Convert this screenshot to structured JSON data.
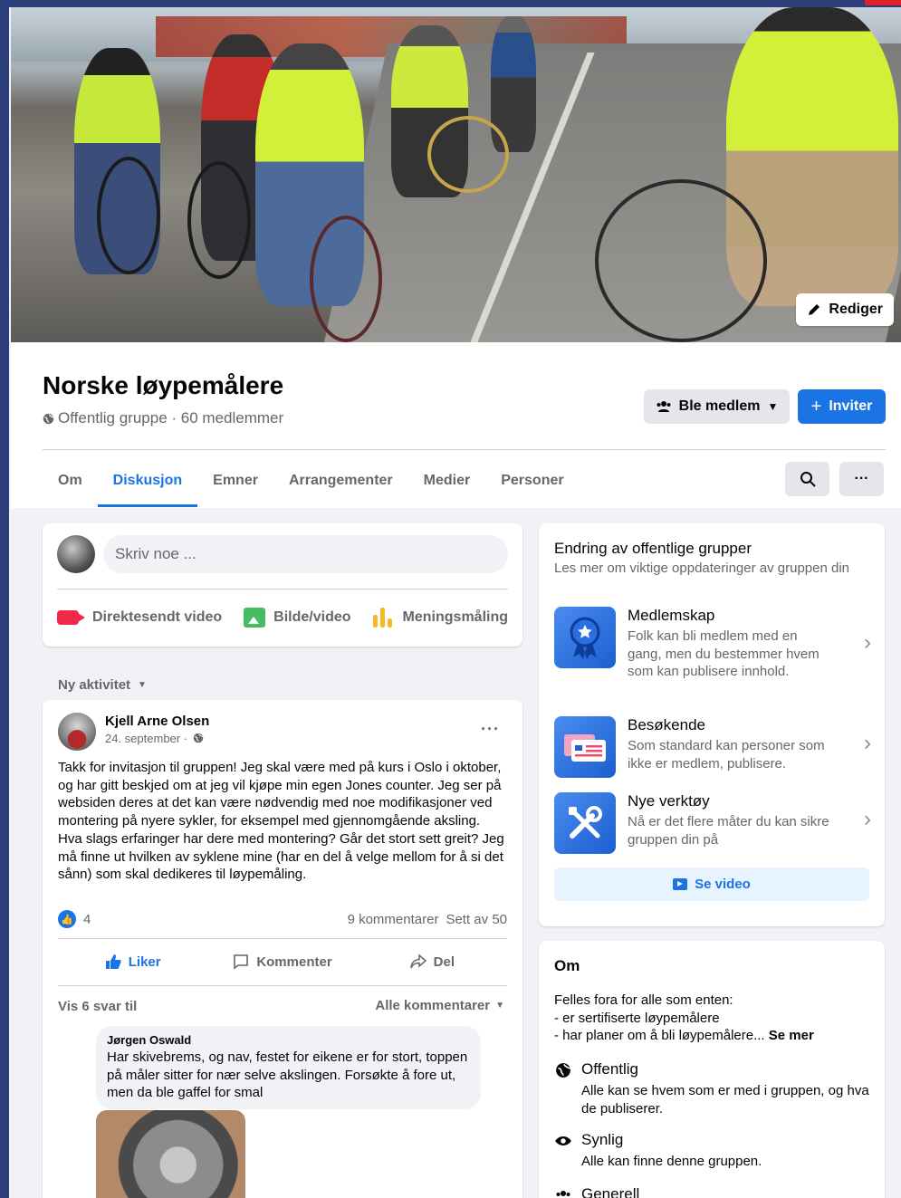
{
  "cover": {
    "edit_label": "Rediger"
  },
  "group": {
    "name": "Norske løypemålere",
    "meta": "Offentlig gruppe · 60 medlemmer",
    "join_label": "Ble medlem",
    "invite_label": "Inviter"
  },
  "tabs": [
    {
      "label": "Om",
      "active": false
    },
    {
      "label": "Diskusjon",
      "active": true
    },
    {
      "label": "Emner",
      "active": false
    },
    {
      "label": "Arrangementer",
      "active": false
    },
    {
      "label": "Medier",
      "active": false
    },
    {
      "label": "Personer",
      "active": false
    }
  ],
  "composer": {
    "placeholder": "Skriv noe ...",
    "actions": [
      "Direktesendt video",
      "Bilde/video",
      "Meningsmåling"
    ]
  },
  "feed": {
    "sort_label": "Ny aktivitet"
  },
  "post": {
    "author": "Kjell Arne Olsen",
    "date": "24. september ·",
    "text": "Takk for invitasjon til gruppen! Jeg skal være med på kurs i Oslo i oktober, og har gitt beskjed om at jeg vil kjøpe min egen Jones counter. Jeg ser på websiden deres at det kan være nødvendig med noe modifikasjoner ved montering på nyere sykler, for eksempel med gjennomgående aksling. Hva slags erfaringer har dere med montering? Går det stort sett greit? Jeg må finne ut hvilken av syklene mine (har en del å velge mellom for å si det sånn) som skal dedikeres til løypemåling.",
    "reactions": "4",
    "comments": "9 kommentarer",
    "seen": "Sett av 50",
    "like_label": "Liker",
    "comment_label": "Kommenter",
    "share_label": "Del",
    "replies_label": "Vis 6 svar til",
    "all_comments_label": "Alle kommentarer",
    "comment": {
      "author": "Jørgen Oswald",
      "text": "Har skivebrems, og nav, festet for eikene er for stort, toppen på måler sitter for nær selve akslingen. Forsøkte å fore ut, men da ble gaffel for smal"
    }
  },
  "sidebar": {
    "title": "Endring av offentlige grupper",
    "subtitle": "Les mer om viktige oppdateringer av gruppen din",
    "features": [
      {
        "title": "Medlemskap",
        "desc": "Folk kan bli medlem med en gang, men du bestemmer hvem som kan publisere innhold.",
        "icon": "badge-icon"
      },
      {
        "title": "Besøkende",
        "desc": "Som standard kan personer som ikke er medlem, publisere.",
        "icon": "visitor-card-icon"
      },
      {
        "title": "Nye verktøy",
        "desc": "Nå er det flere måter du kan sikre gruppen din på",
        "icon": "tools-icon"
      }
    ],
    "video_label": "Se video"
  },
  "about": {
    "title": "Om",
    "desc_lines": [
      "Felles fora for alle som enten:",
      "- er sertifiserte løypemålere",
      "- har planer om å bli løypemålere..."
    ],
    "see_more": "Se mer",
    "rows": [
      {
        "title": "Offentlig",
        "desc": "Alle kan se hvem som er med i gruppen, og hva de publiserer.",
        "icon": "globe-icon"
      },
      {
        "title": "Synlig",
        "desc": "Alle kan finne denne gruppen.",
        "icon": "eye-icon"
      },
      {
        "title": "Generell",
        "desc": "",
        "icon": "group-icon"
      }
    ]
  },
  "colors": {
    "accent": "#1b74e4",
    "background": "#f0f2f5",
    "secondary_text": "#65676b"
  }
}
